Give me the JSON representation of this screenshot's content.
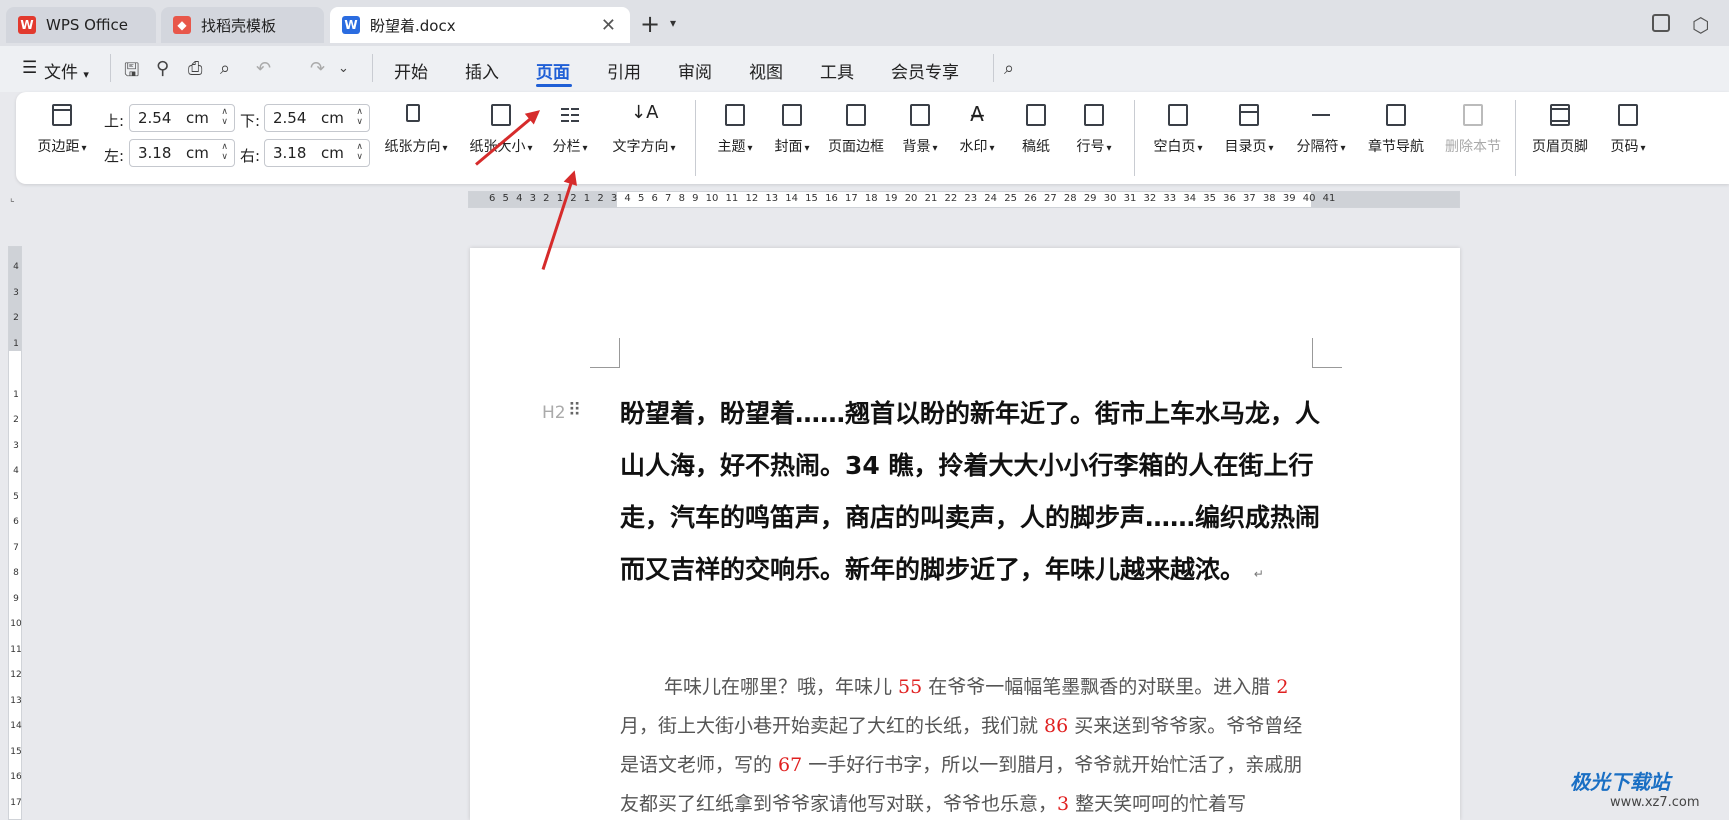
{
  "tabs": [
    {
      "label": "WPS Office",
      "icon": "wps-logo-icon",
      "color": "#e23a2e"
    },
    {
      "label": "找稻壳模板",
      "icon": "docer-icon",
      "color": "#e8574a"
    },
    {
      "label": "盼望着.docx",
      "icon": "word-doc-icon",
      "color": "#2b6ce0",
      "active": true
    }
  ],
  "menu": {
    "file_label": "文件",
    "tabs": [
      "开始",
      "插入",
      "页面",
      "引用",
      "审阅",
      "视图",
      "工具",
      "会员专享"
    ],
    "active_tab": "页面"
  },
  "ribbon": {
    "margins": {
      "label": "页边距",
      "top_label": "上:",
      "top_value": "2.54",
      "bottom_label": "下:",
      "bottom_value": "2.54",
      "left_label": "左:",
      "left_value": "3.18",
      "right_label": "右:",
      "right_value": "3.18",
      "unit": "cm"
    },
    "buttons": [
      "纸张方向",
      "纸张大小",
      "分栏",
      "文字方向",
      "主题",
      "封面",
      "页面边框",
      "背景",
      "水印",
      "稿纸",
      "行号",
      "空白页",
      "目录页",
      "分隔符",
      "章节导航",
      "删除本节",
      "页眉页脚",
      "页码"
    ]
  },
  "ruler": {
    "h_numbers": "6 5 4 3 2 1 2 1 2 3 4 5 6 7 8 9 10 11 12 13 14 15 16 17 18 19 20 21 22 23 24 25 26 27 28 29 30 31 32 33 34 35 36 37 38 39 40 41",
    "v_numbers": [
      "4",
      "3",
      "2",
      "1",
      "",
      "1",
      "2",
      "3",
      "4",
      "5",
      "6",
      "7",
      "8",
      "9",
      "10",
      "11",
      "12",
      "13",
      "14",
      "15",
      "16",
      "17"
    ]
  },
  "document": {
    "heading_tag": "H2",
    "heading": "盼望着，盼望着……翘首以盼的新年近了。街市上车水马龙，人山人海，好不热闹。34 瞧，拎着大大小小行李箱的人在街上行走，汽车的鸣笛声，商店的叫卖声，人的脚步声……编织成热闹而又吉祥的交响乐。新年的脚步近了，年味儿越来越浓。",
    "para_mark": "↵",
    "body_parts": [
      {
        "t": "年味儿在哪里？哦，年味儿 "
      },
      {
        "t": "55",
        "num": true
      },
      {
        "t": " 在爷爷一幅幅笔墨飘香的对联里。进入腊 "
      },
      {
        "t": "2",
        "num": true
      },
      {
        "t": " 月，街上大街小巷开始卖起了大红的长纸，我们就 "
      },
      {
        "t": "86",
        "num": true
      },
      {
        "t": " 买来送到爷爷家。爷爷曾经是语文老师，写的 "
      },
      {
        "t": "67",
        "num": true
      },
      {
        "t": " 一手好行书字，所以一到腊月，爷爷就开始忙活了，亲戚朋友都买了红纸拿到爷爷家请他写对联，爷爷也乐意，"
      },
      {
        "t": "3",
        "num": true
      },
      {
        "t": " 整天笑呵呵的忙着写"
      }
    ]
  },
  "watermark": {
    "title": "极光下载站",
    "url": "www.xz7.com"
  }
}
